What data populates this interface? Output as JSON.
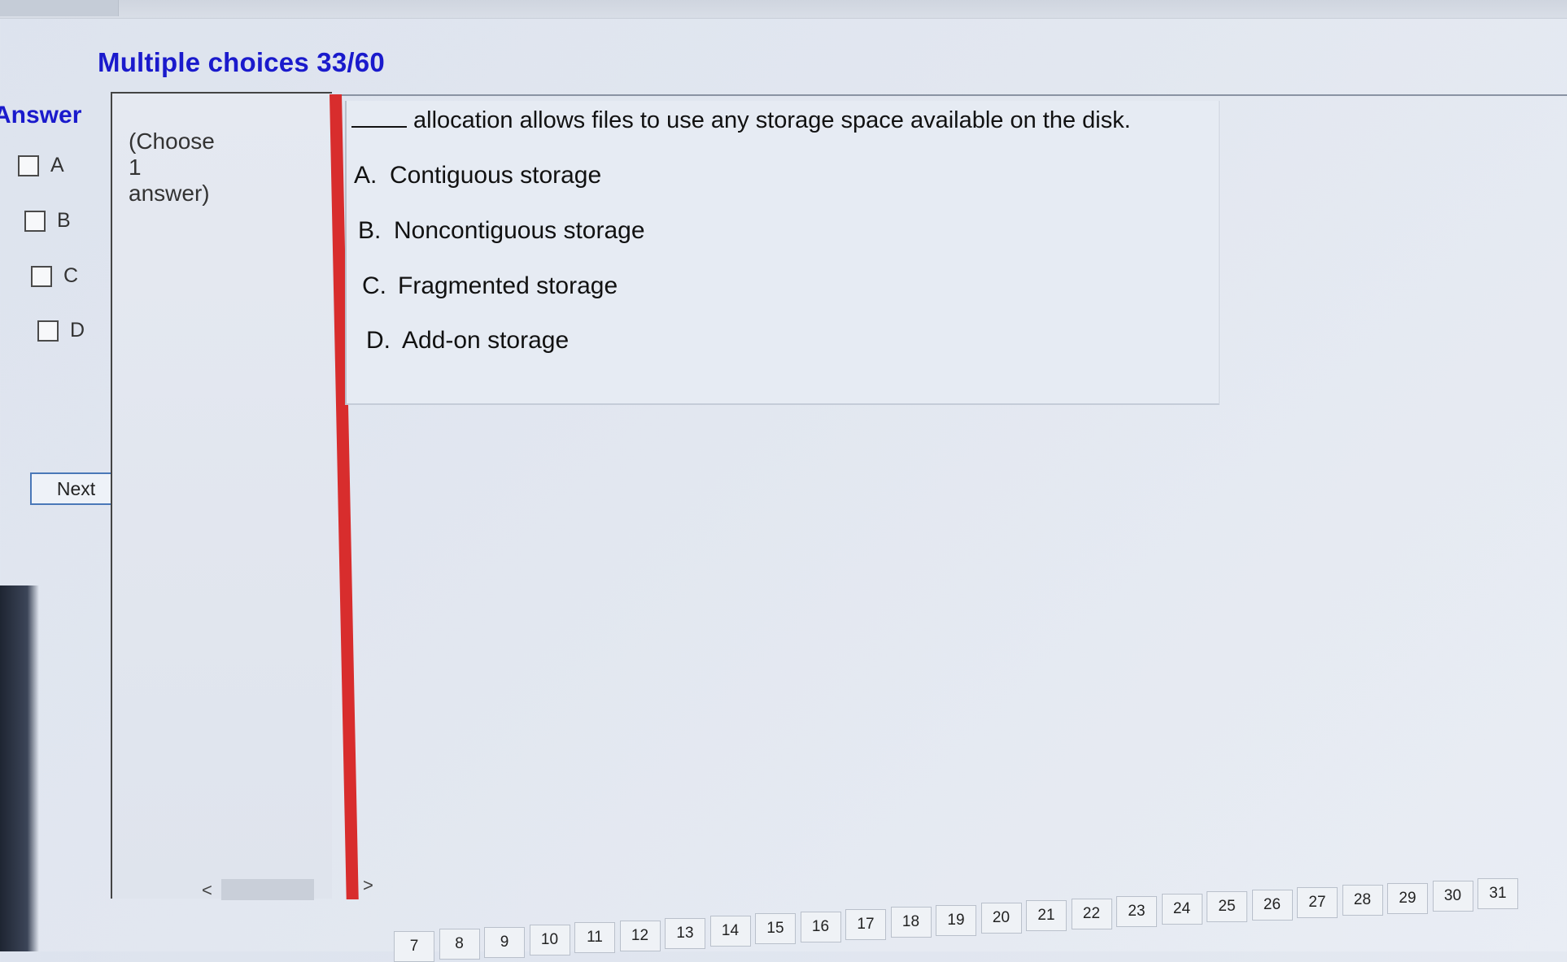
{
  "header": {
    "title": "Multiple choices 33/60"
  },
  "answer_panel": {
    "heading": "Answer",
    "options": [
      {
        "label": "A"
      },
      {
        "label": "B"
      },
      {
        "label": "C"
      },
      {
        "label": "D"
      }
    ],
    "next_label": "Next"
  },
  "instruction": {
    "line1": "(Choose",
    "line2": "1",
    "line3": "answer)"
  },
  "scrollbar": {
    "left_arrow": "<",
    "right_arrow": ">"
  },
  "question": {
    "text": "allocation allows files to use any storage space available on the disk.",
    "choices": [
      {
        "letter": "A.",
        "text": "Contiguous storage"
      },
      {
        "letter": "B.",
        "text": "Noncontiguous storage"
      },
      {
        "letter": "C.",
        "text": "Fragmented storage"
      },
      {
        "letter": "D.",
        "text": "Add-on storage"
      }
    ]
  },
  "pagination": {
    "pages": [
      "7",
      "8",
      "9",
      "10",
      "11",
      "12",
      "13",
      "14",
      "15",
      "16",
      "17",
      "18",
      "19",
      "20",
      "21",
      "22",
      "23",
      "24",
      "25",
      "26",
      "27",
      "28",
      "29",
      "30",
      "31"
    ]
  },
  "colors": {
    "accent_title": "#1a1acc",
    "divider_red": "#d82d2d"
  }
}
